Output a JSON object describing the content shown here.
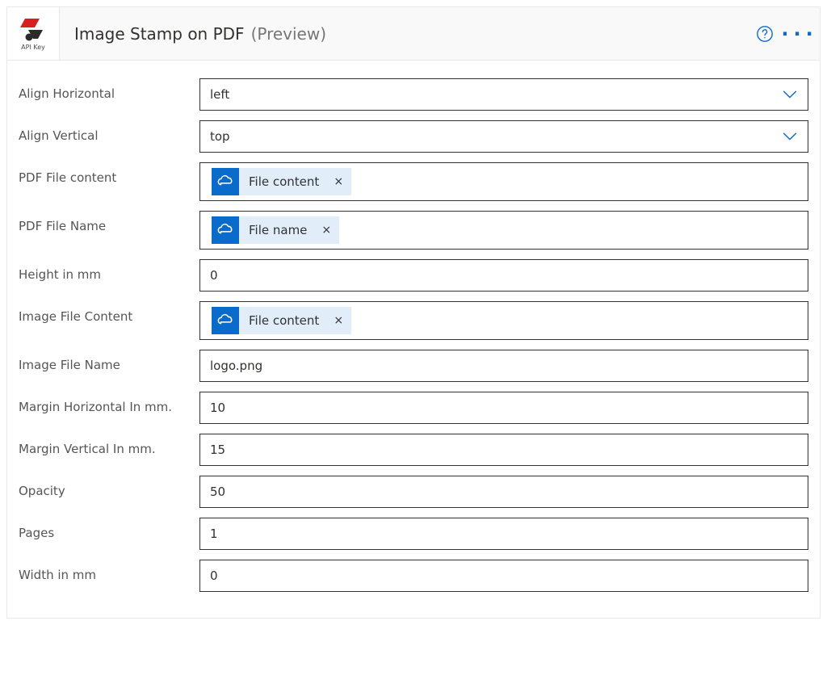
{
  "connector": {
    "icon_label": "API Key"
  },
  "header": {
    "title": "Image Stamp on PDF",
    "preview_suffix": "(Preview)"
  },
  "fields": {
    "align_horizontal": {
      "label": "Align Horizontal",
      "value": "left"
    },
    "align_vertical": {
      "label": "Align Vertical",
      "value": "top"
    },
    "pdf_file_content": {
      "label": "PDF File content",
      "token": "File content"
    },
    "pdf_file_name": {
      "label": "PDF File Name",
      "token": "File name"
    },
    "height_mm": {
      "label": "Height in mm",
      "value": "0"
    },
    "image_file_content": {
      "label": "Image File Content",
      "token": "File content"
    },
    "image_file_name": {
      "label": "Image File Name",
      "value": "logo.png"
    },
    "margin_h": {
      "label": "Margin Horizontal In mm.",
      "value": "10"
    },
    "margin_v": {
      "label": "Margin Vertical In mm.",
      "value": "15"
    },
    "opacity": {
      "label": "Opacity",
      "value": "50"
    },
    "pages": {
      "label": "Pages",
      "value": "1"
    },
    "width_mm": {
      "label": "Width in mm",
      "value": "0"
    }
  }
}
